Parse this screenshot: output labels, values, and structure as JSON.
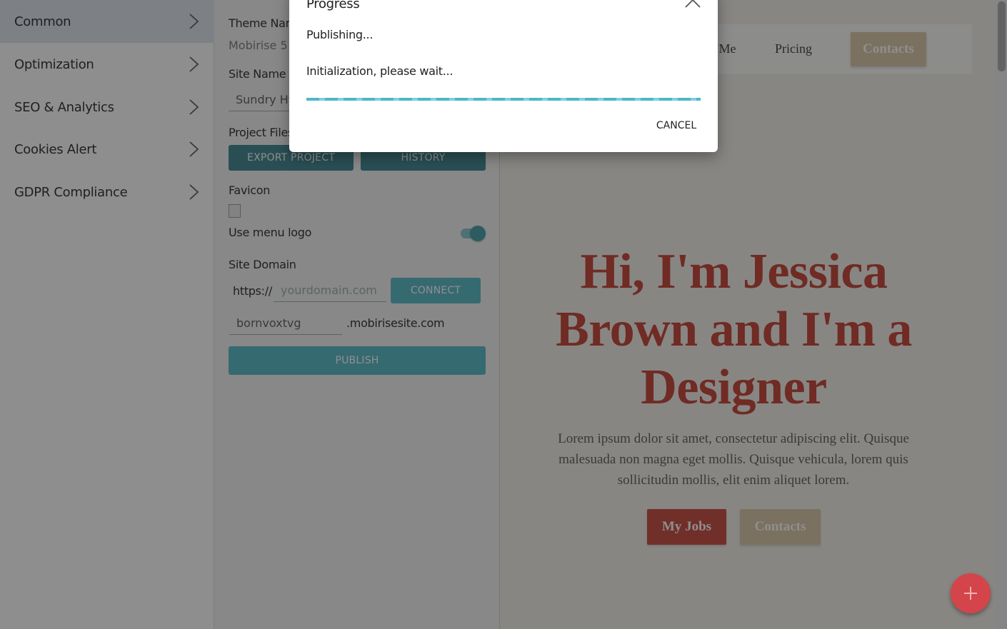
{
  "left_menu": {
    "items": [
      {
        "label": "Common",
        "icon": "chevron-right-icon"
      },
      {
        "label": "Optimization",
        "icon": "chevron-right-icon"
      },
      {
        "label": "SEO & Analytics",
        "icon": "chevron-right-icon"
      },
      {
        "label": "Cookies Alert",
        "icon": "chevron-right-icon"
      },
      {
        "label": "GDPR Compliance",
        "icon": "chevron-right-icon"
      }
    ]
  },
  "settings": {
    "theme_name_label": "Theme Name",
    "theme_name_value": "Mobirise 5",
    "site_name_label": "Site Name",
    "site_name_value": "Sundry Hyp",
    "project_files_label": "Project Files",
    "export_label": "EXPORT PROJECT",
    "history_label": "HISTORY",
    "favicon_label": "Favicon",
    "use_menu_logo_label": "Use menu logo",
    "use_menu_logo_on": true,
    "site_domain_label": "Site Domain",
    "domain_prefix": "https://",
    "domain_placeholder": "yourdomain.com",
    "connect_label": "CONNECT",
    "subdomain_value": "bornvoxtvg",
    "subdomain_suffix": ".mobirisesite.com",
    "publish_label": "PUBLISH"
  },
  "preview": {
    "nav_about": "t Me",
    "nav_pricing": "Pricing",
    "nav_contacts": "Contacts",
    "hero_title": "Hi, I'm Jessica Brown and I'm a Designer",
    "hero_text": "Lorem ipsum dolor sit amet, consectetur adipiscing elit. Quisque malesuada non magna eget mollis. Quisque vehicula, lorem quis sollicitudin mollis, elit enim aliquet lorem.",
    "btn_jobs": "My Jobs",
    "btn_contacts": "Contacts"
  },
  "dialog": {
    "title": "Progress",
    "status": "Publishing...",
    "detail": "Initialization, please wait...",
    "cancel_label": "CANCEL"
  },
  "colors": {
    "accent_teal": "#4fb7c4",
    "brand_red": "#c44036",
    "sand": "#d9c4a3"
  },
  "icons": {
    "close": "chevron-up-icon",
    "fab": "plus-icon"
  }
}
